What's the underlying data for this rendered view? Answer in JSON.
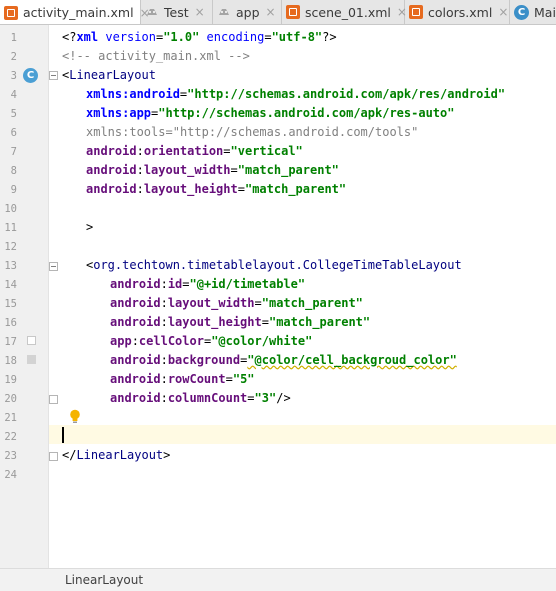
{
  "tabs": [
    {
      "label": "activity_main.xml",
      "icon": "xml-file-icon",
      "active": true
    },
    {
      "label": "Test",
      "icon": "android-module-icon",
      "active": false
    },
    {
      "label": "app",
      "icon": "android-module-icon",
      "active": false
    },
    {
      "label": "scene_01.xml",
      "icon": "xml-file-icon",
      "active": false
    },
    {
      "label": "colors.xml",
      "icon": "xml-file-icon",
      "active": false
    },
    {
      "label": "Mai",
      "icon": "class-icon",
      "active": false
    }
  ],
  "tab_close_glyph": "×",
  "line_numbers": [
    "1",
    "2",
    "3",
    "4",
    "5",
    "6",
    "7",
    "8",
    "9",
    "10",
    "11",
    "12",
    "13",
    "14",
    "15",
    "16",
    "17",
    "18",
    "19",
    "20",
    "21",
    "22",
    "23",
    "24"
  ],
  "gutter_marker_letter": "C",
  "code": {
    "l1": {
      "open": "<?",
      "xml": "xml",
      "sp1": " ",
      "a1": "version",
      "eq1": "=",
      "v1": "\"1.0\"",
      "sp2": " ",
      "a2": "encoding",
      "eq2": "=",
      "v2": "\"utf-8\"",
      "close": "?>"
    },
    "l2": "<!-- activity_main.xml -->",
    "l3": {
      "lt": "<",
      "tag": "LinearLayout"
    },
    "l4": {
      "ns": "xmlns:android",
      "eq": "=",
      "val": "\"http://schemas.android.com/apk/res/android\""
    },
    "l5": {
      "ns": "xmlns:app",
      "eq": "=",
      "val": "\"http://schemas.android.com/apk/res-auto\""
    },
    "l6": {
      "ns": "xmlns:tools",
      "eq": "=",
      "val": "\"http://schemas.android.com/tools\""
    },
    "l7": {
      "ns": "android",
      "colon": ":",
      "attr": "orientation",
      "eq": "=",
      "val": "\"vertical\""
    },
    "l8": {
      "ns": "android",
      "colon": ":",
      "attr": "layout_width",
      "eq": "=",
      "val": "\"match_parent\""
    },
    "l9": {
      "ns": "android",
      "colon": ":",
      "attr": "layout_height",
      "eq": "=",
      "val": "\"match_parent\""
    },
    "l11": ">",
    "l13": {
      "lt": "<",
      "tag": "org.techtown.timetablelayout.CollegeTimeTableLayout"
    },
    "l14": {
      "ns": "android",
      "colon": ":",
      "attr": "id",
      "eq": "=",
      "val": "\"@+id/timetable\""
    },
    "l15": {
      "ns": "android",
      "colon": ":",
      "attr": "layout_width",
      "eq": "=",
      "val": "\"match_parent\""
    },
    "l16": {
      "ns": "android",
      "colon": ":",
      "attr": "layout_height",
      "eq": "=",
      "val": "\"match_parent\""
    },
    "l17": {
      "ns": "app",
      "colon": ":",
      "attr": "cellColor",
      "eq": "=",
      "val": "\"@color/white\""
    },
    "l18": {
      "ns": "android",
      "colon": ":",
      "attr": "background",
      "eq": "=",
      "val": "\"@color/cell_backgroud_color\""
    },
    "l19": {
      "ns": "android",
      "colon": ":",
      "attr": "rowCount",
      "eq": "=",
      "val": "\"5\""
    },
    "l20": {
      "ns": "android",
      "colon": ":",
      "attr": "columnCount",
      "eq": "=",
      "val": "\"3\"",
      "end": "/>"
    },
    "l23": {
      "lt": "</",
      "tag": "LinearLayout",
      "gt": ">"
    }
  },
  "breadcrumb": "LinearLayout",
  "colors": {
    "tag": "#000080",
    "attribute_namespace": "#660e7a",
    "attribute_value": "#008000",
    "xmlns": "#0000ff",
    "comment": "#808080",
    "current_line": "#fffae3",
    "swatch_white": "#ffffff",
    "swatch_cell_background": "#d3d3d3"
  }
}
